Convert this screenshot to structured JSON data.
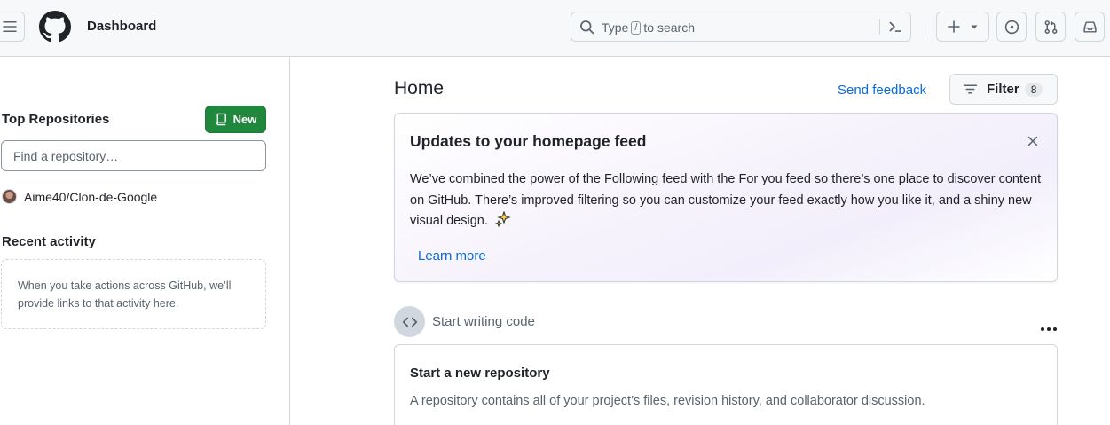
{
  "header": {
    "title": "Dashboard",
    "search": {
      "prefix": "Type",
      "key": "/",
      "suffix": "to search"
    },
    "icons": [
      "hamburger-icon",
      "github-logo",
      "search-icon",
      "command-palette-icon",
      "plus-icon",
      "triangle-down-icon",
      "issue-opened-icon",
      "git-pull-request-icon",
      "inbox-icon"
    ]
  },
  "sidebar": {
    "top_repositories_title": "Top Repositories",
    "new_button_label": "New",
    "find_repo_placeholder": "Find a repository…",
    "repositories": [
      {
        "name": "Aime40/Clon-de-Google"
      }
    ],
    "recent_activity_title": "Recent activity",
    "recent_activity_empty": "When you take actions across GitHub, we’ll provide links to that activity here."
  },
  "main": {
    "title": "Home",
    "send_feedback": "Send feedback",
    "filter_label": "Filter",
    "filter_count": "8",
    "update_card": {
      "title": "Updates to your homepage feed",
      "body": "We’ve combined the power of the Following feed with the For you feed so there’s one place to discover content on GitHub. There’s improved filtering so you can customize your feed exactly how you like it, and a shiny new visual design.",
      "learn_more": "Learn more"
    },
    "start_writing_code": "Start writing code",
    "new_repo_card": {
      "title": "Start a new repository",
      "description": "A repository contains all of your project’s files, revision history, and collaborator discussion."
    }
  },
  "colors": {
    "header_bg": "#f6f8fa",
    "border": "#d0d7de",
    "accent_link": "#0969da",
    "new_button_bg": "#1f883d",
    "text": "#1f2328",
    "muted_text": "#59636e"
  }
}
